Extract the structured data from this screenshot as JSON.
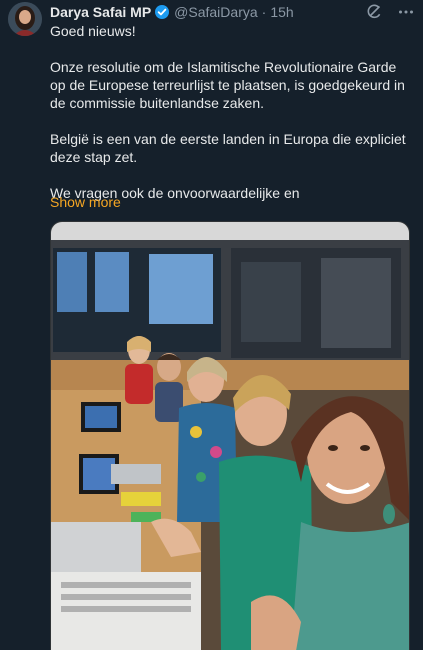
{
  "author": {
    "display_name": "Darya Safai MP",
    "handle": "@SafaiDarya",
    "separator": "·",
    "time": "15h"
  },
  "tweet": {
    "line1": "Goed nieuws!",
    "line2": "Onze resolutie om de Islamitische Revolutionaire Garde op de Europese terreurlijst te plaatsen, is goedgekeurd in de commissie buitenlandse zaken.",
    "line3": "België is een van de eerste landen in Europa die expliciet deze stap zet.",
    "line4": "We vragen ook de onvoorwaardelijke en",
    "show_more": "Show more"
  },
  "icons": {
    "verified": "verified-badge-icon",
    "grok": "grok-icon",
    "more": "more-horizontal-icon"
  },
  "colors": {
    "background": "#15202b",
    "text": "#e7e9ea",
    "muted": "#8b98a5",
    "accent": "#f5a623",
    "verified": "#1d9bf0"
  }
}
